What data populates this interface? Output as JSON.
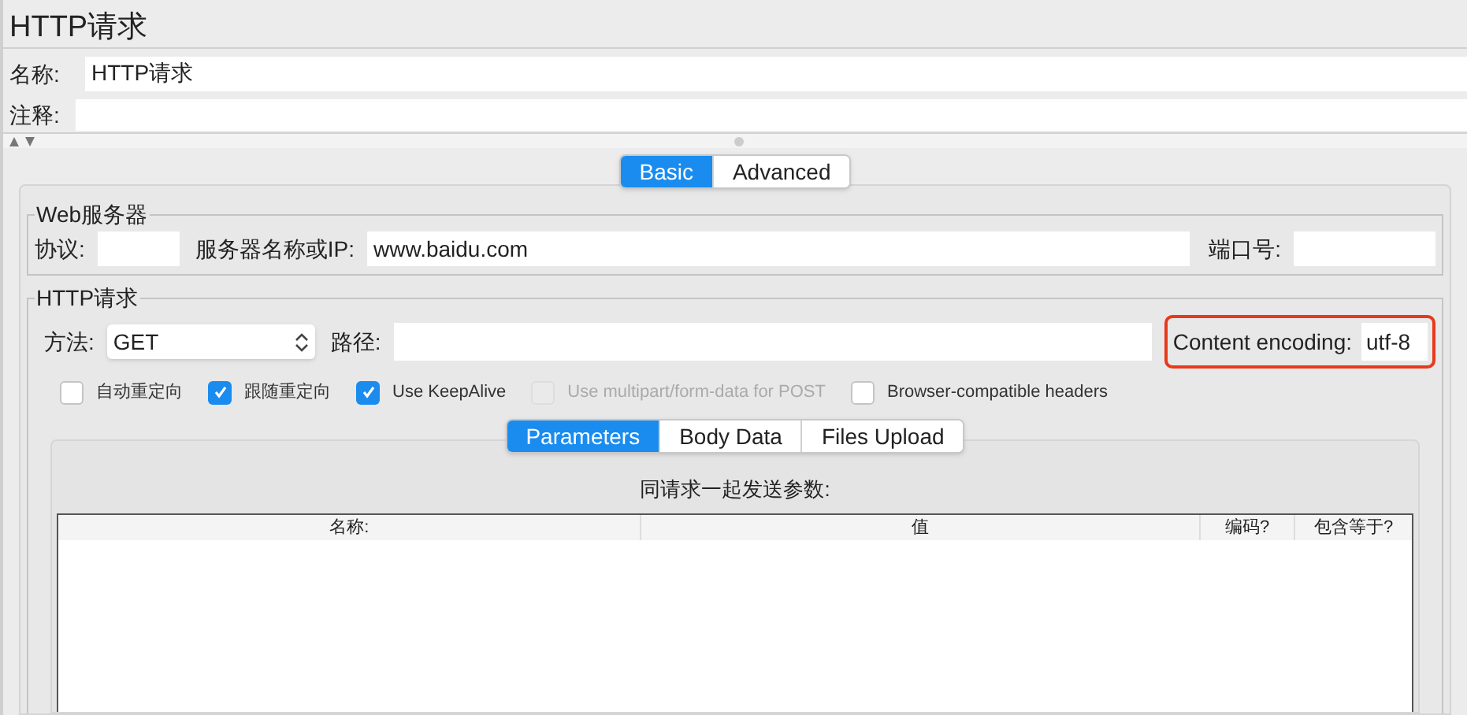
{
  "title": "HTTP请求",
  "name_field": {
    "label": "名称:",
    "value": "HTTP请求"
  },
  "comment_field": {
    "label": "注释:"
  },
  "main_tabs": [
    {
      "label": "Basic",
      "selected": true
    },
    {
      "label": "Advanced",
      "selected": false
    }
  ],
  "web_server": {
    "title": "Web服务器",
    "protocol_label": "协议:",
    "server_label": "服务器名称或IP:",
    "server_value": "www.baidu.com",
    "port_label": "端口号:"
  },
  "http_request": {
    "title": "HTTP请求",
    "method_label": "方法:",
    "method_value": "GET",
    "path_label": "路径:",
    "encoding_label": "Content encoding:",
    "encoding_value": "utf-8",
    "encoding_highlighted": true
  },
  "options": [
    {
      "label": "自动重定向",
      "checked": false,
      "disabled": false
    },
    {
      "label": "跟随重定向",
      "checked": true,
      "disabled": false
    },
    {
      "label": "Use KeepAlive",
      "checked": true,
      "disabled": false
    },
    {
      "label": "Use multipart/form-data for POST",
      "checked": false,
      "disabled": true
    },
    {
      "label": "Browser-compatible headers",
      "checked": false,
      "disabled": false
    }
  ],
  "sub_tabs": [
    {
      "label": "Parameters",
      "selected": true
    },
    {
      "label": "Body Data",
      "selected": false
    },
    {
      "label": "Files Upload",
      "selected": false
    }
  ],
  "parameters": {
    "caption": "同请求一起发送参数:",
    "columns": [
      "名称:",
      "值",
      "编码?",
      "包含等于?"
    ]
  }
}
